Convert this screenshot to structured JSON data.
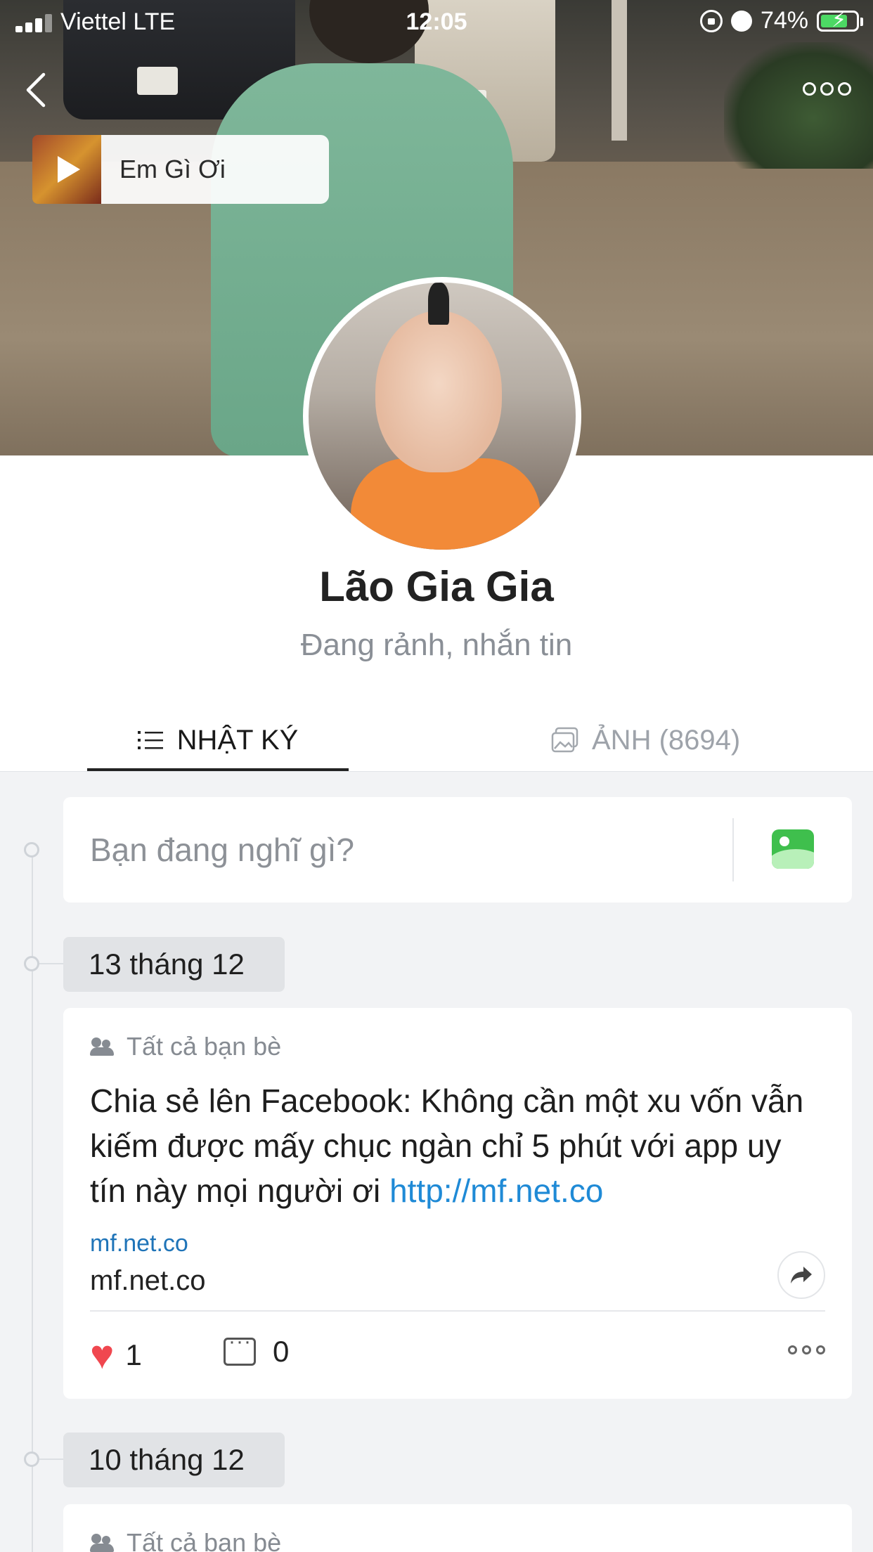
{
  "status_bar": {
    "carrier": "Viettel  LTE",
    "time": "12:05",
    "battery": "74%",
    "battery_level": 0.74
  },
  "music": {
    "title": "Em Gì Ơi"
  },
  "profile": {
    "name": "Lão Gia Gia",
    "bio": "Đang rảnh, nhắn tin"
  },
  "tabs": {
    "diary": "NHẬT KÝ",
    "photos": "ẢNH (8694)"
  },
  "composer": {
    "placeholder": "Bạn đang nghĩ gì?"
  },
  "posts": [
    {
      "date": "13 tháng 12",
      "privacy": "Tất cả bạn bè",
      "text": "Chia sẻ lên Facebook: Không cần một xu vốn vẫn kiếm được mấy chục ngàn chỉ 5 phút với app uy tín này mọi người ơi ",
      "link": "http://mf.net.co",
      "preview_domain": "mf.net.co",
      "preview_title": "mf.net.co",
      "likes": "1",
      "comments": "0"
    },
    {
      "date": "10 tháng 12",
      "privacy": "Tất cả bạn bè"
    }
  ],
  "colors": {
    "link": "#1f8ad6",
    "heart": "#f0474f",
    "image_icon": "#3fbf4d"
  }
}
